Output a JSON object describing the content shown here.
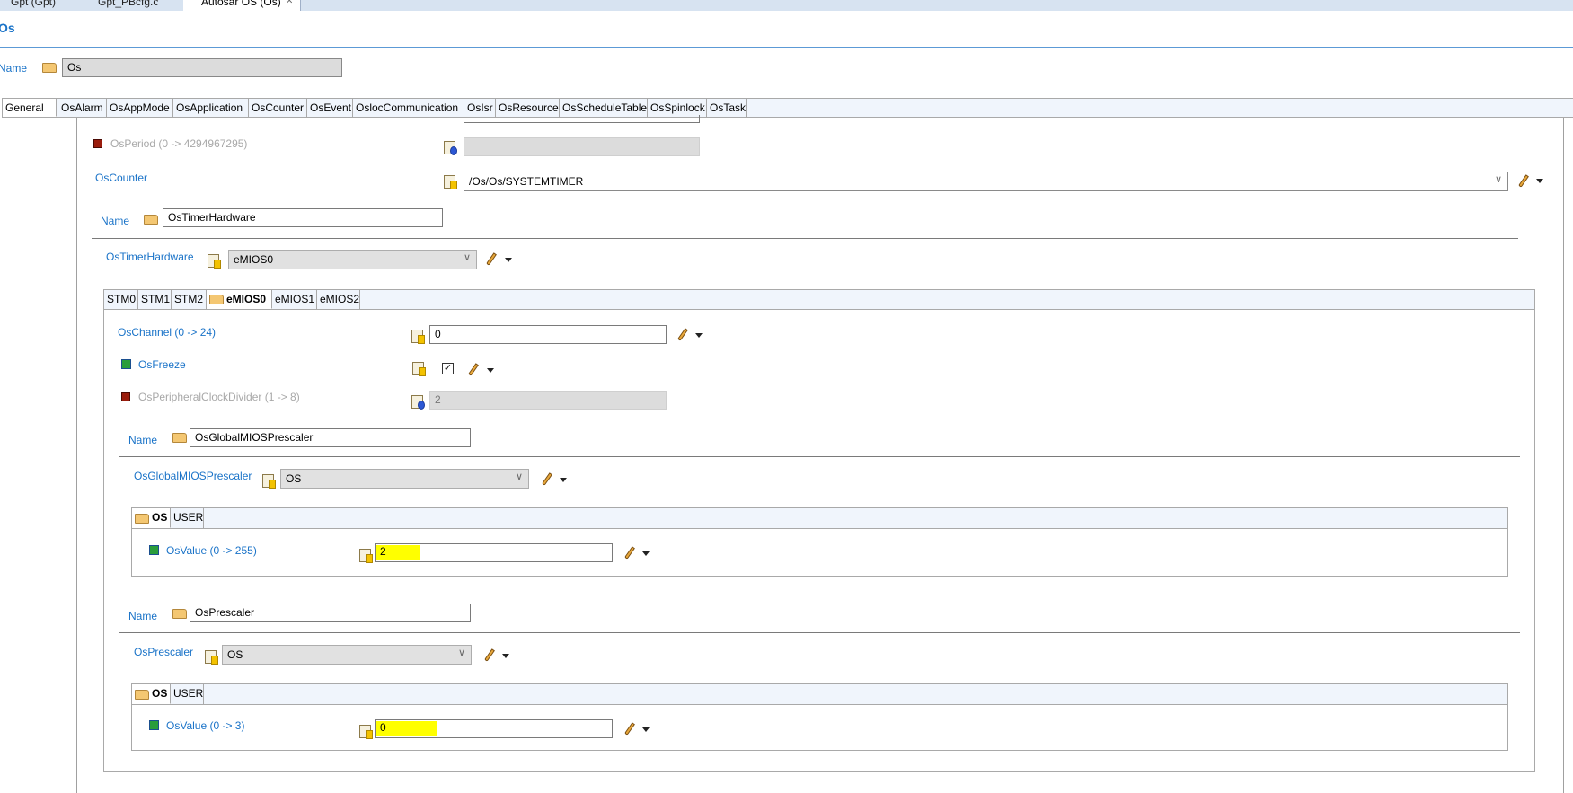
{
  "editor_tabs": [
    {
      "label": "Gpt (Gpt)"
    },
    {
      "label": "Gpt_PBcfg.c"
    },
    {
      "label": "Autosar OS (Os)"
    }
  ],
  "title": "Os",
  "name_label": "Name",
  "name_value": "Os",
  "main_tabs": [
    "General",
    "OsAlarm",
    "OsAppMode",
    "OsApplication",
    "OsCounter",
    "OsEvent",
    "OslocCommunication",
    "OsIsr",
    "OsResource",
    "OsScheduleTable",
    "OsSpinlock",
    "OsTask"
  ],
  "os_period": {
    "label": "OsPeriod (0 -> 4294967295)",
    "value": ""
  },
  "os_counter": {
    "label": "OsCounter",
    "value": "/Os/Os/SYSTEMTIMER"
  },
  "timer_hw_name": {
    "label": "Name",
    "value": "OsTimerHardware"
  },
  "timer_hw": {
    "label": "OsTimerHardware",
    "value": "eMIOS0"
  },
  "hw_tabs": [
    "STM0",
    "STM1",
    "STM2",
    "eMIOS0",
    "eMIOS1",
    "eMIOS2"
  ],
  "os_channel": {
    "label": "OsChannel (0 -> 24)",
    "value": "0"
  },
  "os_freeze": {
    "label": "OsFreeze",
    "checked": true
  },
  "clock_divider": {
    "label": "OsPeripheralClockDivider (1 -> 8)",
    "value": "2"
  },
  "global_prescaler_name": {
    "label": "Name",
    "value": "OsGlobalMIOSPrescaler"
  },
  "global_prescaler": {
    "label": "OsGlobalMIOSPrescaler",
    "value": "OS"
  },
  "global_prescaler_tabs": [
    "OS",
    "USER"
  ],
  "global_value": {
    "label": "OsValue (0 -> 255)",
    "value": "2"
  },
  "prescaler_name": {
    "label": "Name",
    "value": "OsPrescaler"
  },
  "prescaler": {
    "label": "OsPrescaler",
    "value": "OS"
  },
  "prescaler_tabs": [
    "OS",
    "USER"
  ],
  "prescaler_value": {
    "label": "OsValue (0 -> 3)",
    "value": "0"
  },
  "colors": {
    "link": "#1a73c8",
    "highlight": "#ffff00"
  }
}
